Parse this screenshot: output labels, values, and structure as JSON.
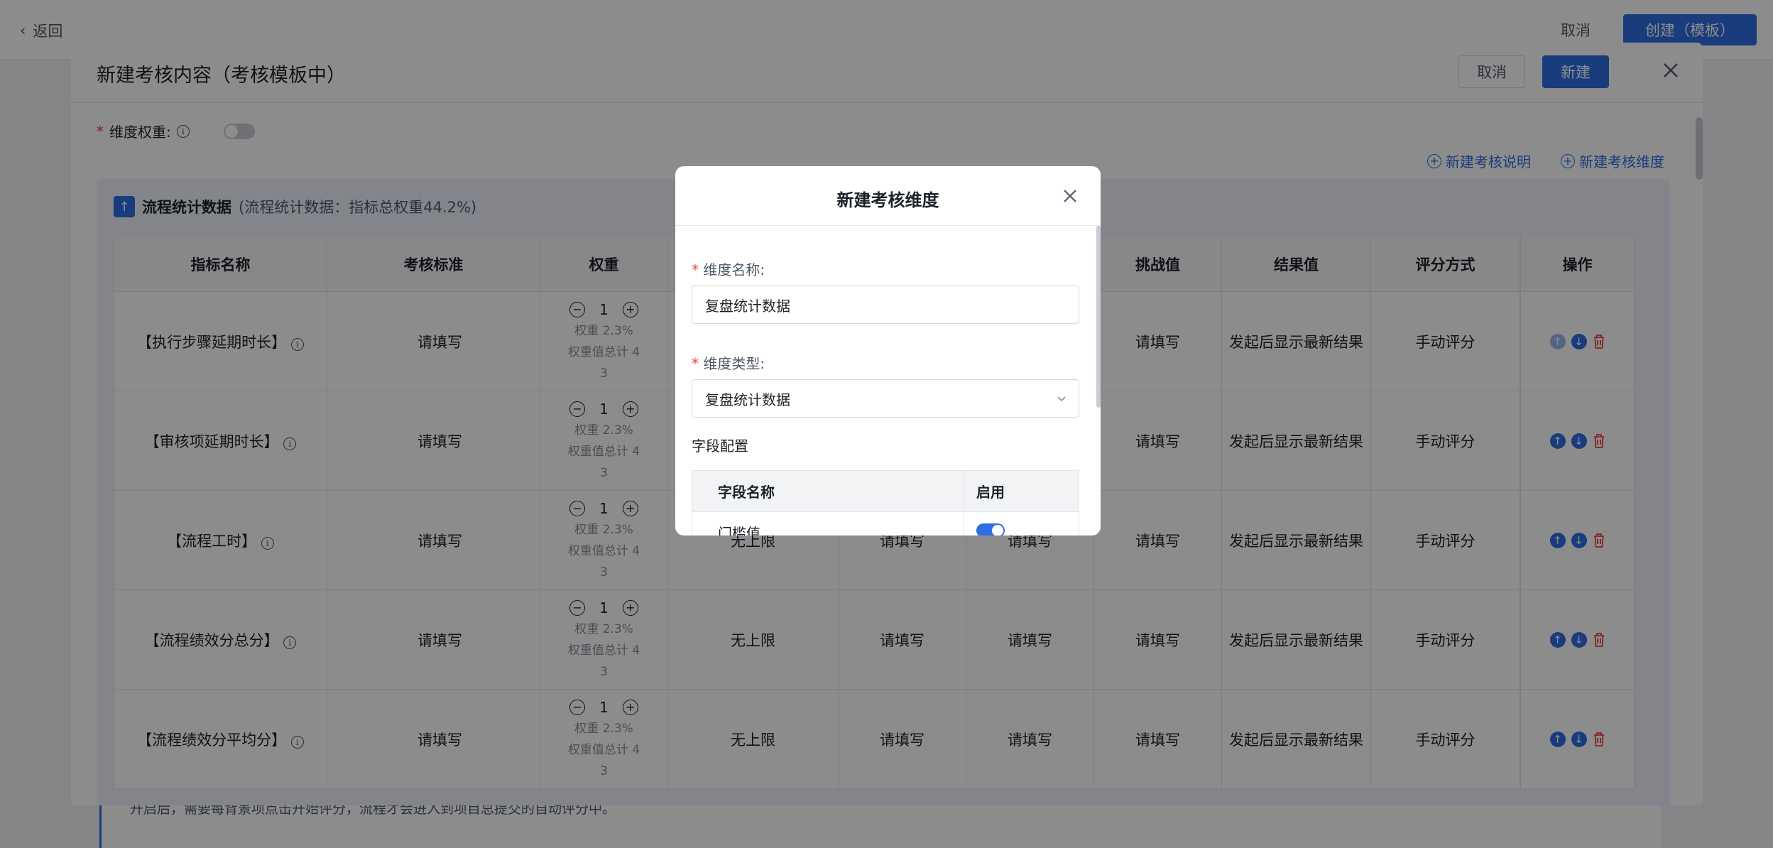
{
  "page": {
    "back_label": "返回",
    "top_cancel": "取消",
    "top_create": "创建（模板）",
    "bottom_text": "开启后，需要每背景项点击开始评分，流程才会进入到项目总提交的自动评分中。"
  },
  "drawer": {
    "title": "新建考核内容（考核模板中）",
    "cancel_label": "取消",
    "new_label": "新建",
    "weight_label": "维度权重:",
    "link_add_desc": "新建考核说明",
    "link_add_dim": "新建考核维度",
    "section_title": "流程统计数据",
    "section_sub": "(流程统计数据：指标总权重44.2%)",
    "columns": [
      "指标名称",
      "考核标准",
      "权重",
      "",
      "",
      "",
      "挑战值",
      "结果值",
      "评分方式",
      "",
      "操作"
    ],
    "rows": [
      {
        "name": "【执行步骤延期时长】",
        "standard": "请填写",
        "weight": "1",
        "weight_pct": "权重 2.3%",
        "weight_total_a": "权重值总计 4",
        "weight_total_b": "3",
        "limit": "",
        "v1": "",
        "v2": "",
        "challenge": "请填写",
        "result": "发起后显示最新结果",
        "scoring": "手动评分"
      },
      {
        "name": "【审核项延期时长】",
        "standard": "请填写",
        "weight": "1",
        "weight_pct": "权重 2.3%",
        "weight_total_a": "权重值总计 4",
        "weight_total_b": "3",
        "limit": "",
        "v1": "",
        "v2": "",
        "challenge": "请填写",
        "result": "发起后显示最新结果",
        "scoring": "手动评分"
      },
      {
        "name": "【流程工时】",
        "standard": "请填写",
        "weight": "1",
        "weight_pct": "权重 2.3%",
        "weight_total_a": "权重值总计 4",
        "weight_total_b": "3",
        "limit": "无上限",
        "v1": "请填写",
        "v2": "请填写",
        "challenge": "请填写",
        "result": "发起后显示最新结果",
        "scoring": "手动评分"
      },
      {
        "name": "【流程绩效分总分】",
        "standard": "请填写",
        "weight": "1",
        "weight_pct": "权重 2.3%",
        "weight_total_a": "权重值总计 4",
        "weight_total_b": "3",
        "limit": "无上限",
        "v1": "请填写",
        "v2": "请填写",
        "challenge": "请填写",
        "result": "发起后显示最新结果",
        "scoring": "手动评分"
      },
      {
        "name": "【流程绩效分平均分】",
        "standard": "请填写",
        "weight": "1",
        "weight_pct": "权重 2.3%",
        "weight_total_a": "权重值总计 4",
        "weight_total_b": "3",
        "limit": "无上限",
        "v1": "请填写",
        "v2": "请填写",
        "challenge": "请填写",
        "result": "发起后显示最新结果",
        "scoring": "手动评分"
      }
    ]
  },
  "modal": {
    "title": "新建考核维度",
    "name_label": "维度名称:",
    "name_value": "复盘统计数据",
    "type_label": "维度类型:",
    "type_value": "复盘统计数据",
    "field_config_label": "字段配置",
    "col_field_name": "字段名称",
    "col_enabled": "启用",
    "row1_name": "门槛值"
  },
  "colors": {
    "accent": "#2f6de3",
    "danger": "#f53f3f",
    "placeholder": "#c9cdd4"
  }
}
